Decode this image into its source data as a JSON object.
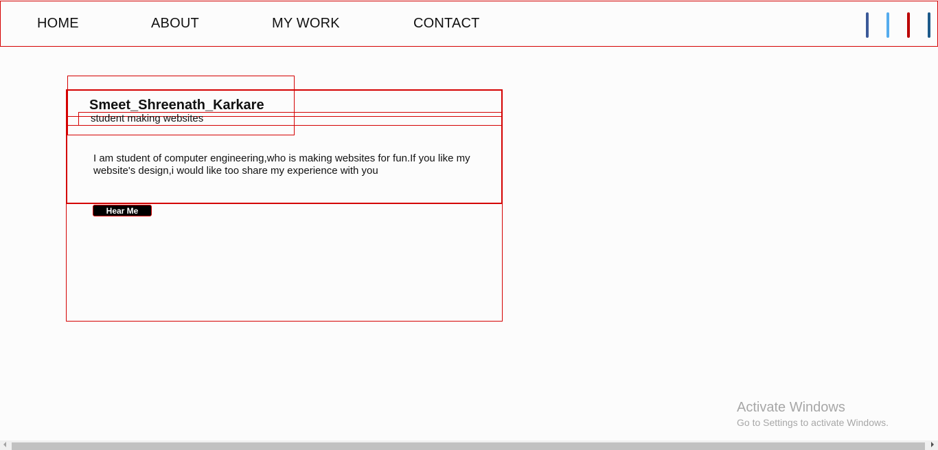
{
  "nav": {
    "links": [
      "HOME",
      "ABOUT",
      "MY WORK",
      "CONTACT"
    ]
  },
  "social": {
    "icons": [
      "facebook-icon",
      "twitter-icon",
      "youtube-icon",
      "linkedin-icon"
    ],
    "colors": [
      "#3b5998",
      "#55acee",
      "#bb0000",
      "#1d5a8a"
    ]
  },
  "profile": {
    "name": "Smeet_Shreenath_Karkare",
    "tagline": "student making websites",
    "bio": "I am student of computer engineering,who is making websites for fun.If you like my website's design,i would like too share my experience with you",
    "button_label": "Hear Me"
  },
  "watermark": {
    "title": "Activate Windows",
    "subtitle": "Go to Settings to activate Windows."
  },
  "colors": {
    "accent_border": "#d40000",
    "button_bg": "#000000",
    "page_bg": "#fcfcfc"
  }
}
